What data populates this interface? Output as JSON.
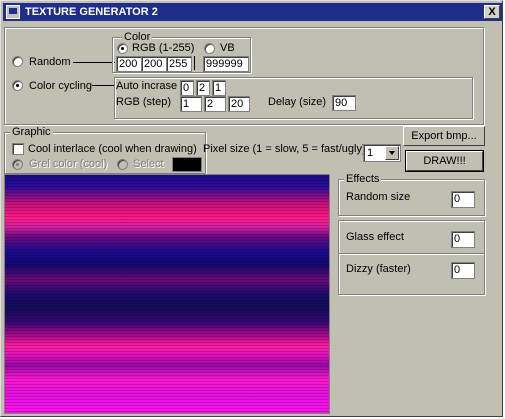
{
  "window": {
    "title": "TEXTURE GENERATOR 2",
    "close_label": "X"
  },
  "mode": {
    "random_label": "Random",
    "cycling_label": "Color cycling",
    "selected": "cycling"
  },
  "color": {
    "group_label": "Color",
    "rgb_label": "RGB (1-255)",
    "vb_label": "VB",
    "selected": "rgb",
    "r": "200",
    "g": "200",
    "b": "255",
    "vb_value": "999999"
  },
  "cycling": {
    "auto_label": "Auto incrase",
    "auto_r": "0",
    "auto_g": "2",
    "auto_b": "1",
    "step_label": "RGB (step)",
    "step_r": "1",
    "step_g": "2",
    "step_b": "20",
    "delay_label": "Delay (size)",
    "delay_value": "90"
  },
  "graphic": {
    "group_label": "Graphic",
    "interlace_label": "Cool interlace (cool when drawing)",
    "interlace_checked": false,
    "grey_label": "Grel color (cool)",
    "select_label": "Select",
    "select_color": "#000000"
  },
  "pixel": {
    "label": "Pixel size (1 = slow, 5 = fast/ugly)",
    "value": "1"
  },
  "buttons": {
    "export": "Export bmp...",
    "draw": "DRAW!!!"
  },
  "effects": {
    "group_label": "Effects",
    "random_size_label": "Random size",
    "random_size_value": "0",
    "glass_label": "Glass effect",
    "glass_value": "0",
    "dizzy_label": "Dizzy (faster)",
    "dizzy_value": "0"
  }
}
